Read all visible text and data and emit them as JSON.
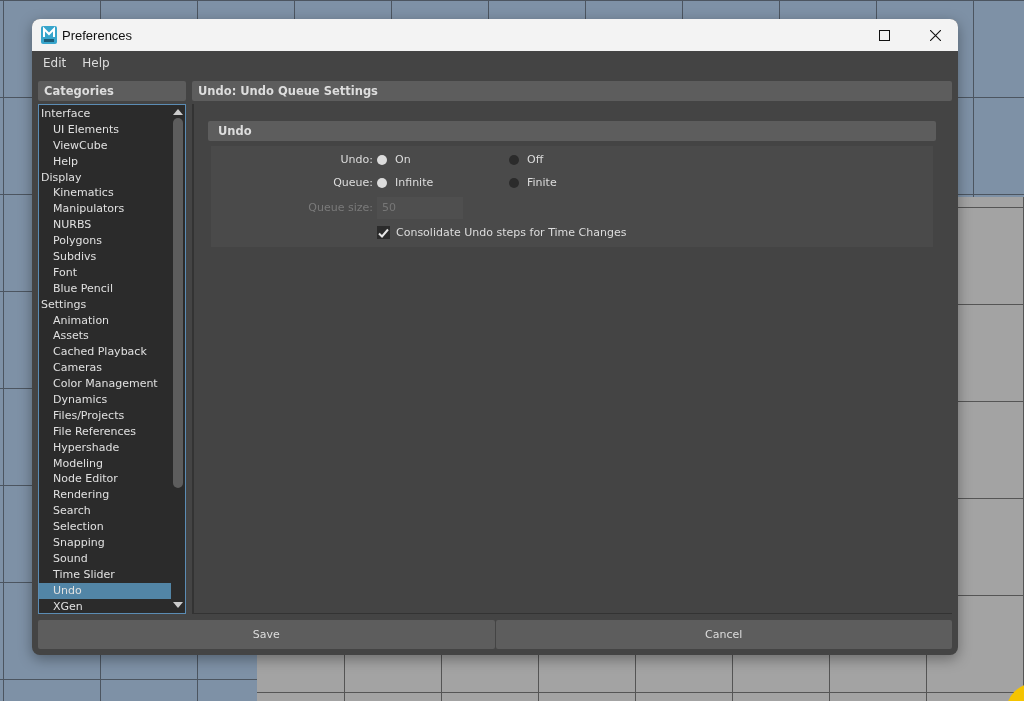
{
  "window": {
    "title": "Preferences"
  },
  "menu": [
    "Edit",
    "Help"
  ],
  "categories": {
    "title": "Categories",
    "items": [
      {
        "label": "Interface",
        "selected": false,
        "children": [
          {
            "label": "UI Elements",
            "selected": false
          },
          {
            "label": "ViewCube",
            "selected": false
          },
          {
            "label": "Help",
            "selected": false
          }
        ]
      },
      {
        "label": "Display",
        "selected": false,
        "children": [
          {
            "label": "Kinematics",
            "selected": false
          },
          {
            "label": "Manipulators",
            "selected": false
          },
          {
            "label": "NURBS",
            "selected": false
          },
          {
            "label": "Polygons",
            "selected": false
          },
          {
            "label": "Subdivs",
            "selected": false
          },
          {
            "label": "Font",
            "selected": false
          },
          {
            "label": "Blue Pencil",
            "selected": false
          }
        ]
      },
      {
        "label": "Settings",
        "selected": false,
        "children": [
          {
            "label": "Animation",
            "selected": false
          },
          {
            "label": "Assets",
            "selected": false
          },
          {
            "label": "Cached Playback",
            "selected": false
          },
          {
            "label": "Cameras",
            "selected": false
          },
          {
            "label": "Color Management",
            "selected": false
          },
          {
            "label": "Dynamics",
            "selected": false
          },
          {
            "label": "Files/Projects",
            "selected": false
          },
          {
            "label": "File References",
            "selected": false
          },
          {
            "label": "Hypershade",
            "selected": false
          },
          {
            "label": "Modeling",
            "selected": false
          },
          {
            "label": "Node Editor",
            "selected": false
          },
          {
            "label": "Rendering",
            "selected": false
          },
          {
            "label": "Search",
            "selected": false
          },
          {
            "label": "Selection",
            "selected": false
          },
          {
            "label": "Snapping",
            "selected": false
          },
          {
            "label": "Sound",
            "selected": false
          },
          {
            "label": "Time Slider",
            "selected": false
          },
          {
            "label": "Undo",
            "selected": true
          },
          {
            "label": "XGen",
            "selected": false
          }
        ]
      }
    ]
  },
  "panel": {
    "title": "Undo: Undo Queue Settings",
    "section": {
      "title": "Undo",
      "rows": [
        {
          "kind": "radio",
          "label": "Undo:",
          "options": [
            {
              "label": "On",
              "selected": true
            },
            {
              "label": "Off",
              "selected": false
            }
          ]
        },
        {
          "kind": "radio",
          "label": "Queue:",
          "options": [
            {
              "label": "Infinite",
              "selected": true
            },
            {
              "label": "Finite",
              "selected": false
            }
          ]
        },
        {
          "kind": "field",
          "label": "Queue size:",
          "value": "50",
          "disabled": true
        },
        {
          "kind": "checkbox",
          "label": "Consolidate Undo steps for Time Changes",
          "checked": true
        }
      ]
    }
  },
  "buttons": [
    "Save",
    "Cancel"
  ]
}
